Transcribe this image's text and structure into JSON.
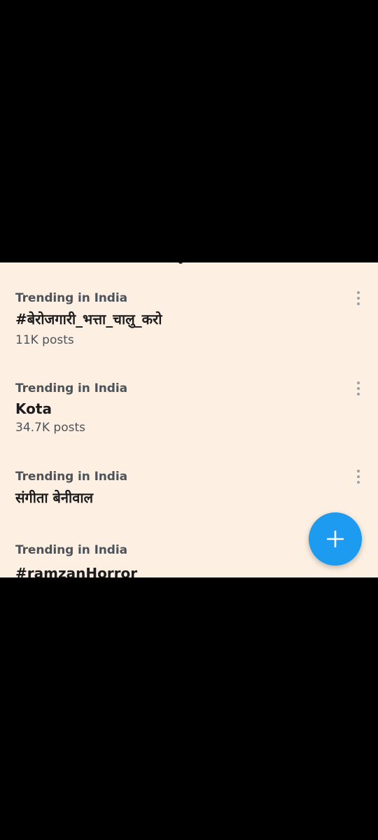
{
  "trends": [
    {
      "context": "Trending in India",
      "title": "#बेरोजगारी_भत्ता_चालु_करो",
      "count": "11K posts"
    },
    {
      "context": "Trending in India",
      "title": "Kota",
      "count": "34.7K posts"
    },
    {
      "context": "Trending in India",
      "title": "संगीता बेनीवाल",
      "count": ""
    },
    {
      "context": "Trending in India",
      "title": "#ramzanHorror",
      "count": ""
    }
  ],
  "icons": {
    "more": "more-vertical-icon",
    "compose": "plus-icon"
  },
  "colors": {
    "background": "#fdf0e2",
    "accent": "#1d9bf0",
    "primary_text": "#1c1c1f",
    "secondary_text": "#4d535a"
  }
}
